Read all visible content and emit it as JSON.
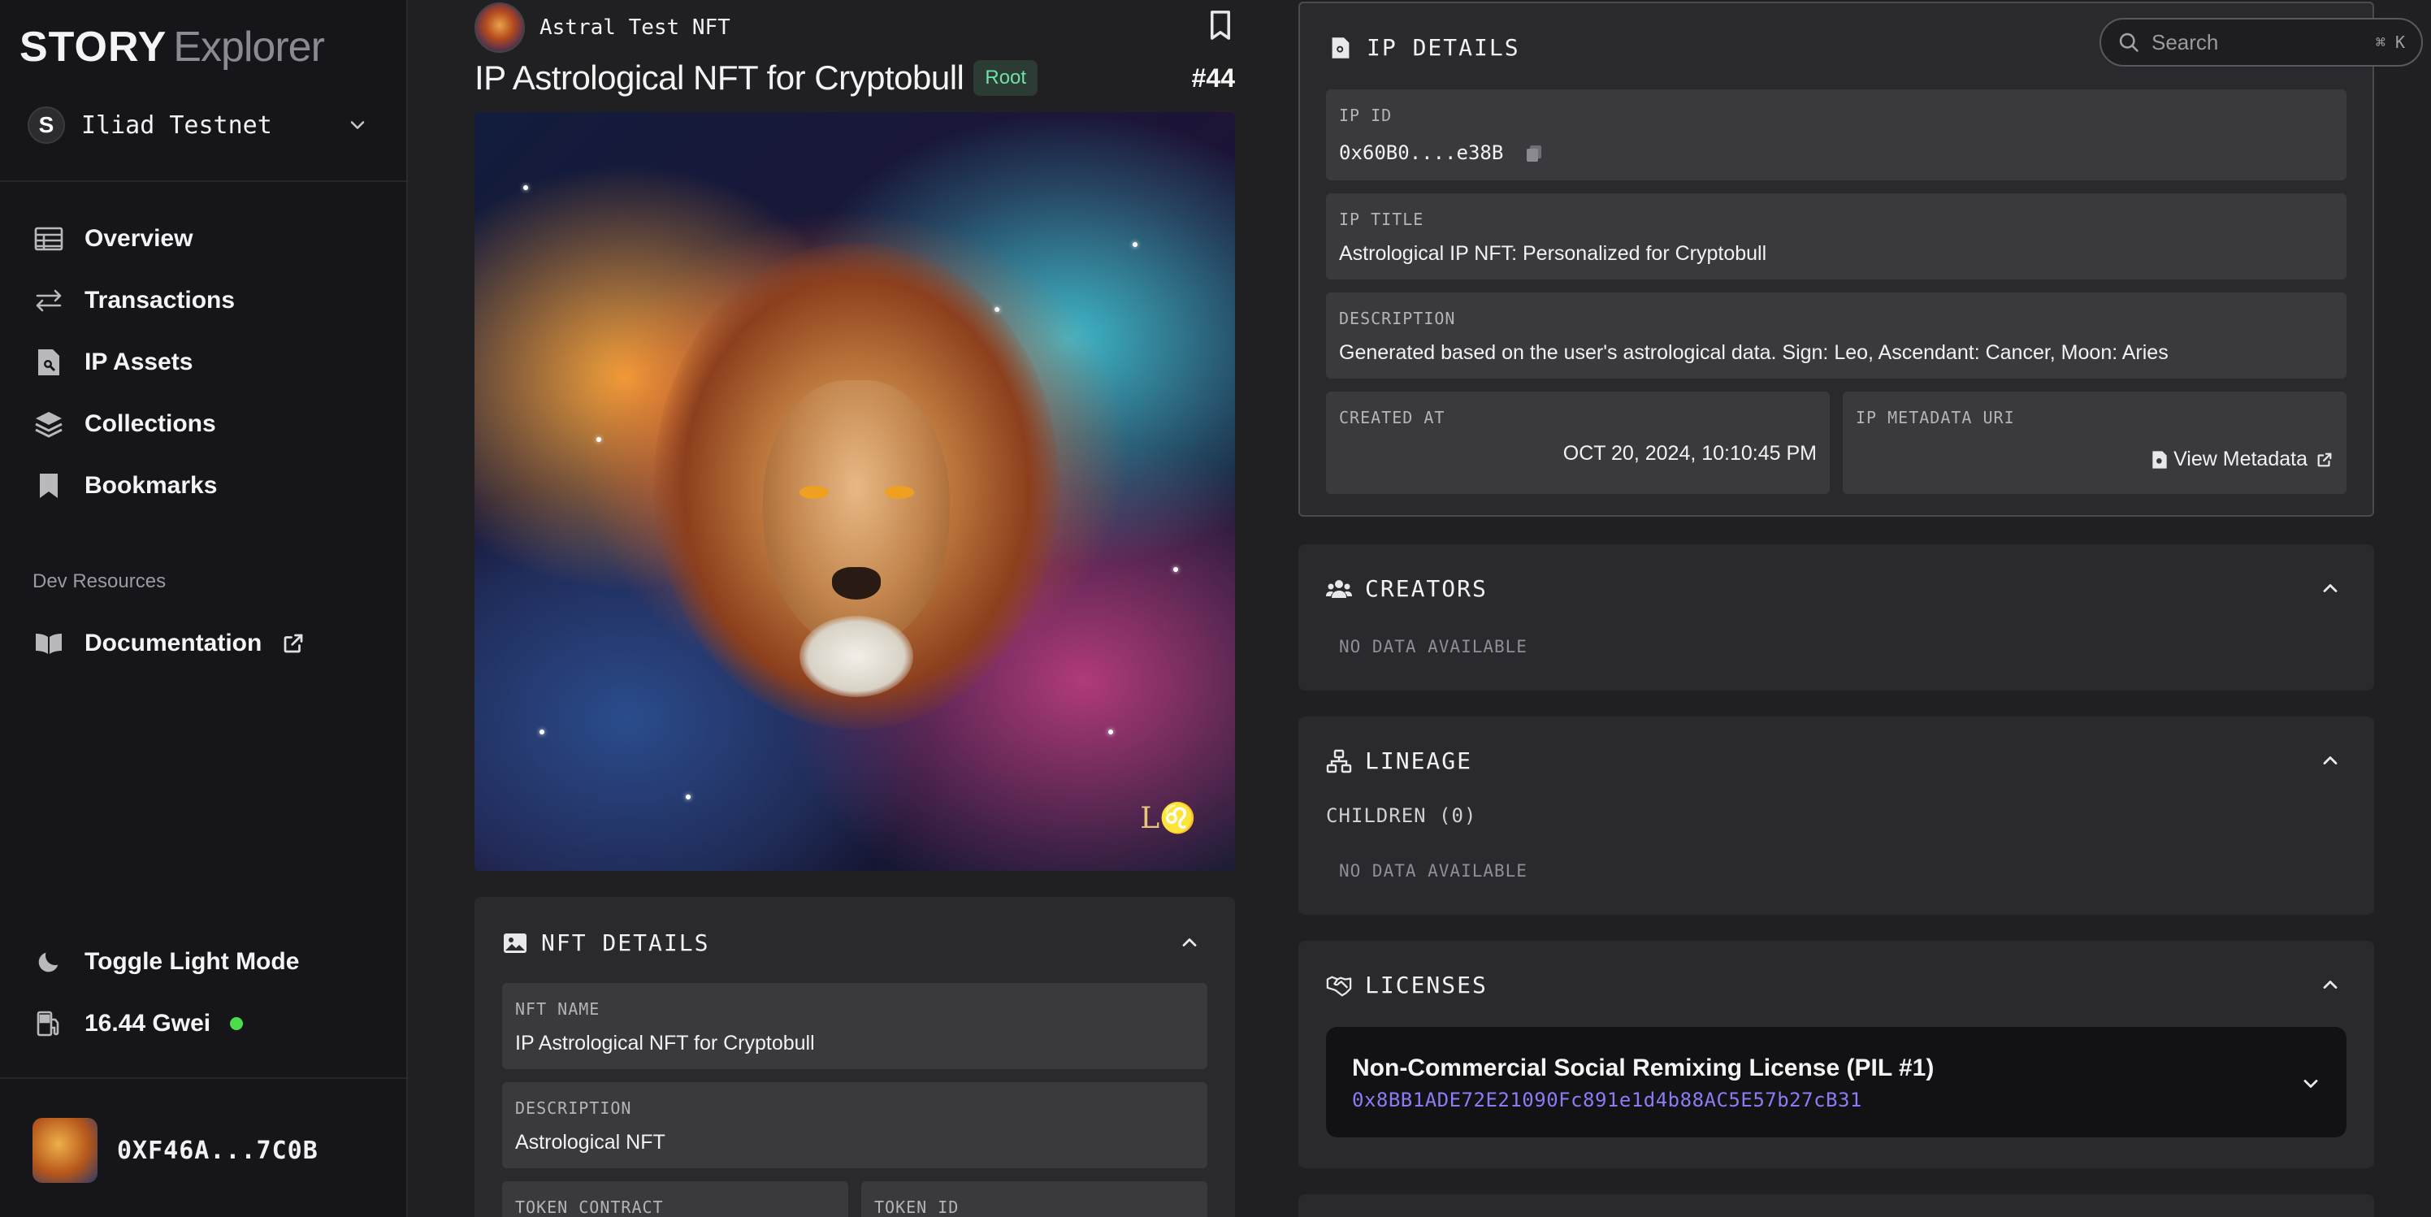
{
  "sidebar": {
    "logo_bold": "STORY",
    "logo_light": "Explorer",
    "network_initial": "S",
    "network_name": "Iliad Testnet",
    "nav": [
      {
        "label": "Overview",
        "icon": "table-icon"
      },
      {
        "label": "Transactions",
        "icon": "arrows-swap-icon"
      },
      {
        "label": "IP Assets",
        "icon": "document-search-icon"
      },
      {
        "label": "Collections",
        "icon": "layers-icon"
      },
      {
        "label": "Bookmarks",
        "icon": "bookmark-icon"
      }
    ],
    "section_label": "Dev Resources",
    "documentation_label": "Documentation",
    "toggle_label": "Toggle Light Mode",
    "gas_label": "16.44 Gwei",
    "wallet_address": "0XF46A...7C0B"
  },
  "asset": {
    "collection_name": "Astral Test NFT",
    "title": "IP Astrological NFT for Cryptobull",
    "badge": "Root",
    "token_number": "#44",
    "art_signature": "L♌"
  },
  "nft_details": {
    "header": "NFT DETAILS",
    "fields": [
      {
        "label": "NFT NAME",
        "value": "IP Astrological NFT for Cryptobull"
      },
      {
        "label": "DESCRIPTION",
        "value": "Astrological NFT"
      },
      {
        "label": "TOKEN CONTRACT",
        "value": ""
      },
      {
        "label": "TOKEN ID",
        "value": ""
      }
    ]
  },
  "search": {
    "placeholder": "Search",
    "shortcut": "⌘ K"
  },
  "ip_details": {
    "header": "IP DETAILS",
    "ip_id_label": "IP ID",
    "ip_id_value": "0x60B0....e38B",
    "ip_title_label": "IP TITLE",
    "ip_title_value": "Astrological IP NFT: Personalized for Cryptobull",
    "description_label": "DESCRIPTION",
    "description_value": "Generated based on the user's astrological data. Sign: Leo, Ascendant: Cancer, Moon: Aries",
    "created_label": "CREATED AT",
    "created_value": "OCT 20, 2024, 10:10:45 PM",
    "metadata_label": "IP METADATA URI",
    "metadata_link": "View Metadata"
  },
  "creators": {
    "header": "CREATORS",
    "empty": "NO DATA AVAILABLE"
  },
  "lineage": {
    "header": "LINEAGE",
    "children_label": "CHILDREN (0)",
    "empty": "NO DATA AVAILABLE"
  },
  "licenses": {
    "header": "LICENSES",
    "items": [
      {
        "name": "Non-Commercial Social Remixing License (PIL #1)",
        "address": "0x8BB1ADE72E21090Fc891e1d4b88AC5E57b27cB31"
      }
    ]
  },
  "colors": {
    "accent_purple": "#8b7cf6",
    "root_green": "#6de3a4",
    "status_green": "#4ade4a"
  }
}
